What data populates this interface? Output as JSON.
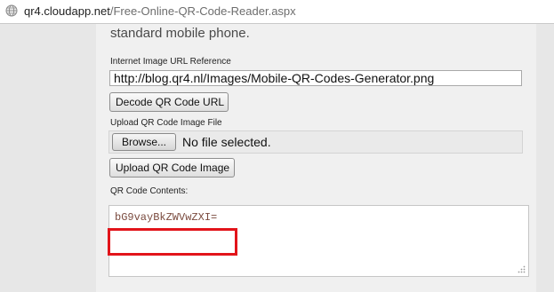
{
  "browser": {
    "url_host": "qr4.cloudapp.net",
    "url_path": "/Free-Online-QR-Code-Reader.aspx"
  },
  "page": {
    "cutoff_text": "standard mobile phone.",
    "url_section": {
      "label": "Internet Image URL Reference",
      "value": "http://blog.qr4.nl/Images/Mobile-QR-Codes-Generator.png",
      "decode_button": "Decode QR Code URL"
    },
    "upload_section": {
      "label": "Upload QR Code Image File",
      "browse_button": "Browse...",
      "file_status": "No file selected.",
      "upload_button": "Upload QR Code Image"
    },
    "contents_section": {
      "label": "QR Code Contents:",
      "value": "bG9vayBkZWVwZXI="
    }
  },
  "colors": {
    "highlight": "#e2141a"
  },
  "icons": [
    "globe-icon",
    "resize-grip-icon"
  ]
}
